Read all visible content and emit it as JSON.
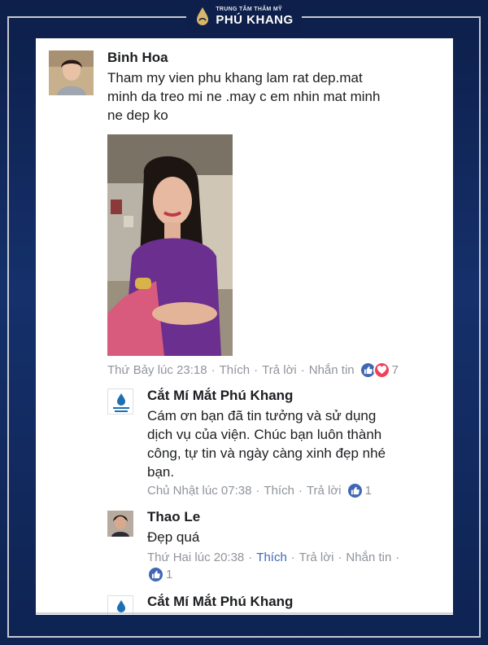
{
  "brand": {
    "small_text": "TRUNG TÂM THẨM MỸ",
    "name": "PHÚ KHANG",
    "accent_color": "#0d1f4a"
  },
  "comments": [
    {
      "author": "Binh Hoa",
      "lines": [
        "Tham my vien phu khang lam rat dep.mat",
        "minh da treo mi ne .may c em nhin mat minh",
        "ne dep ko"
      ],
      "timestamp": "Thứ Bảy lúc 23:18",
      "actions": [
        "Thích",
        "Trả lời",
        "Nhắn tin"
      ],
      "reaction_count": "7"
    },
    {
      "author": "Cắt Mí Mắt Phú Khang",
      "lines": [
        "Cám ơn bạn đã tin tưởng và sử dụng",
        "dịch vụ của viện. Chúc bạn luôn thành",
        "công, tự tin và ngày càng xinh đẹp nhé",
        "bạn."
      ],
      "timestamp": "Chủ Nhật lúc 07:38",
      "actions": [
        "Thích",
        "Trả lời"
      ],
      "reaction_count": "1"
    },
    {
      "author": "Thao Le",
      "lines": [
        "Đẹp quá"
      ],
      "timestamp": "Thứ Hai lúc 20:38",
      "actions": [
        "Thích",
        "Trả lời",
        "Nhắn tin"
      ],
      "reaction_count": "1"
    },
    {
      "author": "Cắt Mí Mắt Phú Khang"
    }
  ],
  "page_logo_text": {
    "small": "TRUNG TÂM THẨM MỸ",
    "name": "PHÚ KHANG"
  },
  "colors": {
    "like_blue": "#4267b2",
    "love_red": "#f33e58",
    "meta_gray": "#90949c"
  }
}
